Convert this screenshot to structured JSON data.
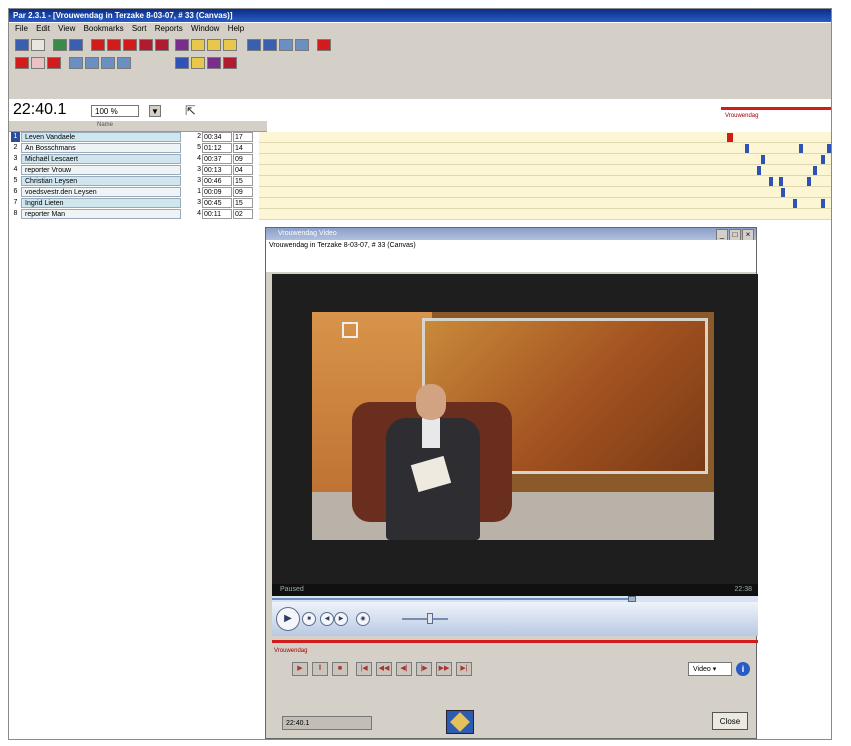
{
  "window": {
    "title": "Par 2.3.1 - [Vrouwendag in Terzake 8-03-07, # 33 (Canvas)]"
  },
  "menu": [
    "File",
    "Edit",
    "View",
    "Bookmarks",
    "Sort",
    "Reports",
    "Window",
    "Help"
  ],
  "toolbar": {
    "timecode": "22:40.1",
    "zoom": "100 %",
    "colors": {
      "red": "#d21b1b",
      "blue": "#2e52b8",
      "yellow": "#e7c84a",
      "green": "#2e8b2e",
      "purple": "#7a2e8a"
    }
  },
  "timeline": {
    "label": "Vrouwendag",
    "column_header_name": "Name"
  },
  "speakers": [
    {
      "num": "1",
      "name": "Leven Vandaele",
      "count": "2",
      "duration": "00:34",
      "pct": "17",
      "selected": true
    },
    {
      "num": "2",
      "name": "An Bosschmans",
      "count": "5",
      "duration": "01:12",
      "pct": "14"
    },
    {
      "num": "3",
      "name": "Michaël Lescaert",
      "count": "4",
      "duration": "00:37",
      "pct": "09"
    },
    {
      "num": "4",
      "name": "reporter Vrouw",
      "count": "3",
      "duration": "00:13",
      "pct": "04"
    },
    {
      "num": "5",
      "name": "Christian Leysen",
      "count": "3",
      "duration": "00:46",
      "pct": "15"
    },
    {
      "num": "6",
      "name": "voedsvestr.den Leysen",
      "count": "1",
      "duration": "00:09",
      "pct": "09"
    },
    {
      "num": "7",
      "name": "Ingrid Lieten",
      "count": "3",
      "duration": "00:45",
      "pct": "15"
    },
    {
      "num": "8",
      "name": "reporter Man",
      "count": "4",
      "duration": "00:11",
      "pct": "02"
    }
  ],
  "video_window": {
    "title": "Vrouwendag Video",
    "subtitle": "Vrouwendag in Terzake 8-03-07, # 33 (Canvas)",
    "status": "Paused",
    "time": "22:38",
    "progress": 0.74,
    "volume": 0.55,
    "label": "Vrouwendag",
    "select_value": "Video",
    "info": "i",
    "timecode_field": "22:40.1",
    "close_label": "Close"
  }
}
